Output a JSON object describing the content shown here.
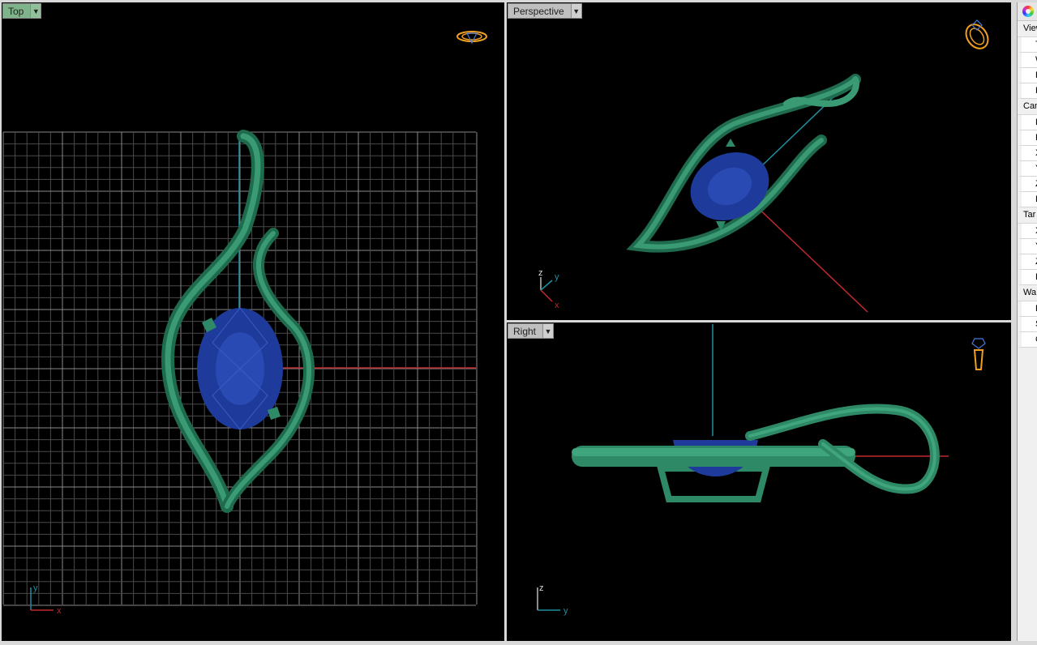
{
  "viewports": {
    "top": {
      "label": "Top"
    },
    "perspective": {
      "label": "Perspective"
    },
    "right": {
      "label": "Right"
    }
  },
  "axes": {
    "x": "x",
    "y": "y",
    "z": "z"
  },
  "colors": {
    "background": "#000000",
    "active_tab": "#7fb48a",
    "metal": "#2e7d5e",
    "gem": "#1e3a9a",
    "grid": "#5a5a5a",
    "x_axis": "#c0282d",
    "y_axis": "#1f8fa0",
    "widget": "#f0a020"
  },
  "properties_panel": {
    "sections": [
      {
        "title": "View",
        "rows": [
          "T",
          "W",
          "H",
          "P"
        ]
      },
      {
        "title": "Cam",
        "rows": [
          "Le",
          "R",
          "X",
          "Y",
          "Z",
          "Le"
        ]
      },
      {
        "title": "Tar",
        "rows": [
          "X",
          "Y",
          "Z",
          "Le"
        ]
      },
      {
        "title": "Wa",
        "rows": [
          "Fi",
          "S",
          "G"
        ]
      }
    ]
  }
}
